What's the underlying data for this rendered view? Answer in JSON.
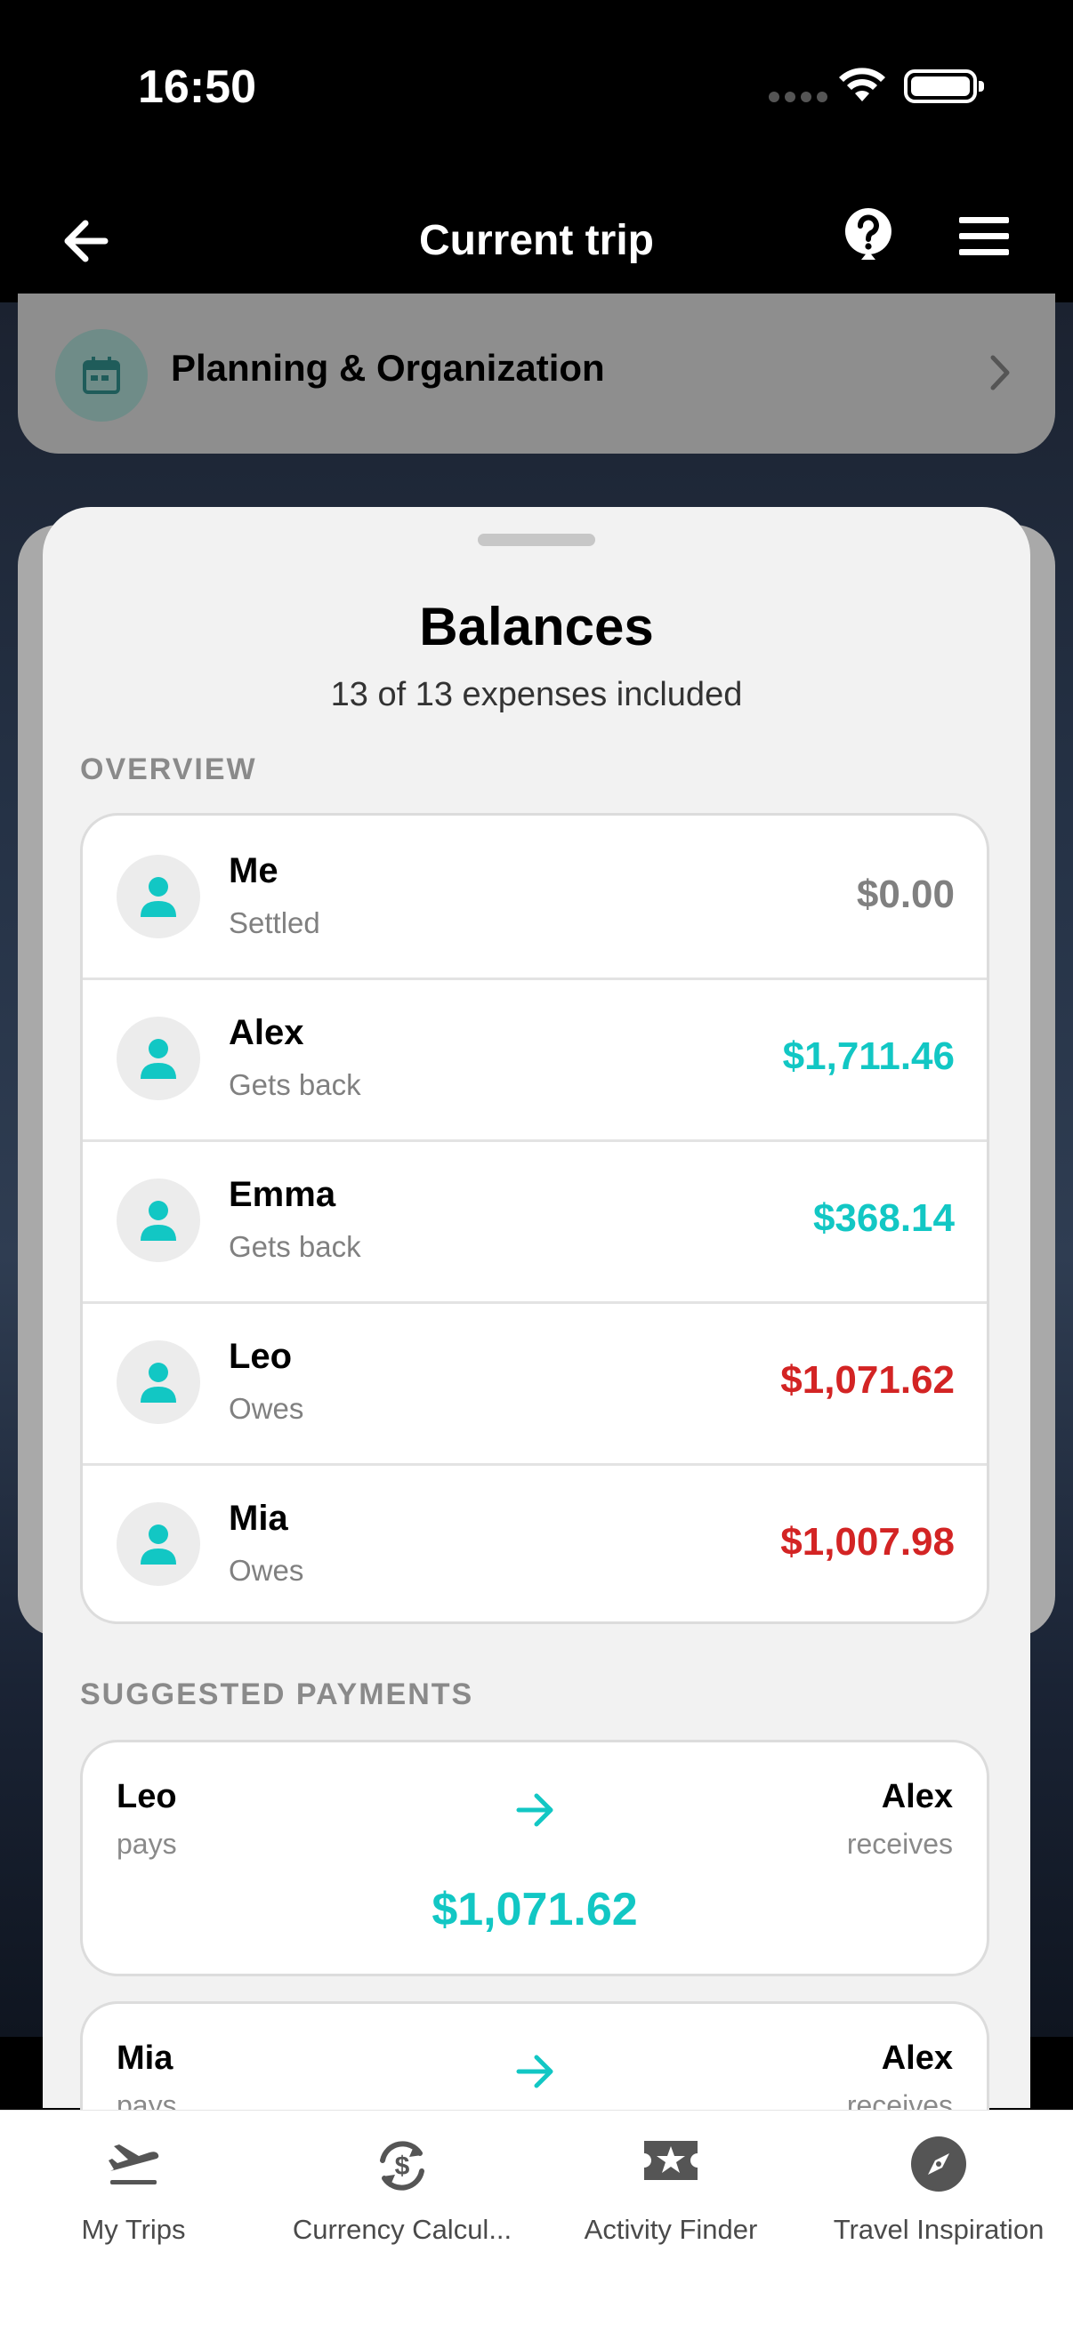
{
  "status_bar": {
    "time": "16:50"
  },
  "nav": {
    "title": "Current trip"
  },
  "planning": {
    "label": "Planning & Organization"
  },
  "sheet": {
    "title": "Balances",
    "subtitle": "13 of 13 expenses included",
    "overview_label": "OVERVIEW",
    "payments_label": "SUGGESTED PAYMENTS"
  },
  "colors": {
    "positive": "#12c7c4",
    "negative": "#d32424",
    "neutral": "#808080"
  },
  "overview": [
    {
      "name": "Me",
      "status": "Settled",
      "amount": "$0.00",
      "kind": "neutral"
    },
    {
      "name": "Alex",
      "status": "Gets back",
      "amount": "$1,711.46",
      "kind": "positive"
    },
    {
      "name": "Emma",
      "status": "Gets back",
      "amount": "$368.14",
      "kind": "positive"
    },
    {
      "name": "Leo",
      "status": "Owes",
      "amount": "$1,071.62",
      "kind": "negative"
    },
    {
      "name": "Mia",
      "status": "Owes",
      "amount": "$1,007.98",
      "kind": "negative"
    }
  ],
  "payments": [
    {
      "payer": "Leo",
      "payer_role": "pays",
      "payee": "Alex",
      "payee_role": "receives",
      "amount": "$1,071.62"
    },
    {
      "payer": "Mia",
      "payer_role": "pays",
      "payee": "Alex",
      "payee_role": "receives",
      "amount": ""
    }
  ],
  "tabs": [
    {
      "label": "My Trips",
      "icon": "airplane-takeoff-icon"
    },
    {
      "label": "Currency Calcul...",
      "icon": "currency-exchange-icon"
    },
    {
      "label": "Activity Finder",
      "icon": "star-ticket-icon"
    },
    {
      "label": "Travel Inspiration",
      "icon": "compass-icon"
    }
  ]
}
